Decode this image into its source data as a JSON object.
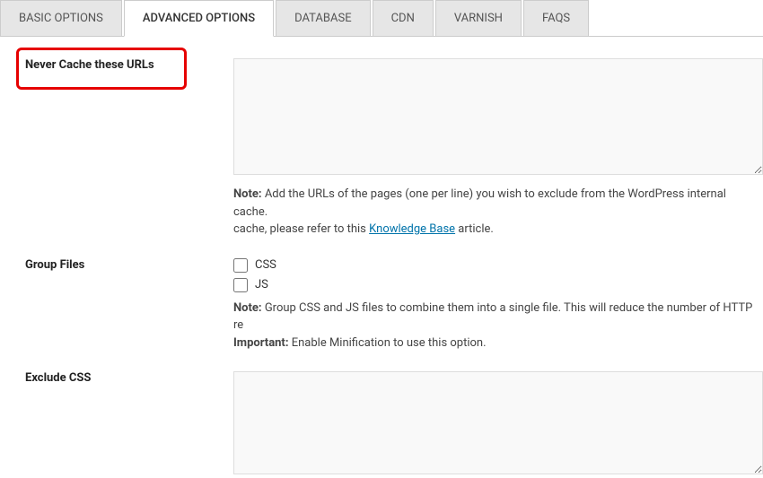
{
  "tabs": {
    "basic": "BASIC OPTIONS",
    "advanced": "ADVANCED OPTIONS",
    "database": "DATABASE",
    "cdn": "CDN",
    "varnish": "VARNISH",
    "faqs": "FAQs"
  },
  "sections": {
    "never_cache": {
      "label": "Never Cache these URLs",
      "value": "",
      "note_prefix": "Note:",
      "note_text": " Add the URLs of the pages (one per line) you wish to exclude from the WordPress internal cache.",
      "note_text2_pre": " cache, please refer to this ",
      "note_link": "Knowledge Base",
      "note_text2_post": " article."
    },
    "group_files": {
      "label": "Group Files",
      "css_label": "CSS",
      "js_label": "JS",
      "note_prefix": "Note:",
      "note_text": " Group CSS and JS files to combine them into a single file. This will reduce the number of HTTP re",
      "important_prefix": "Important:",
      "important_text": " Enable Minification to use this option."
    },
    "exclude_css": {
      "label": "Exclude CSS",
      "value": ""
    }
  }
}
